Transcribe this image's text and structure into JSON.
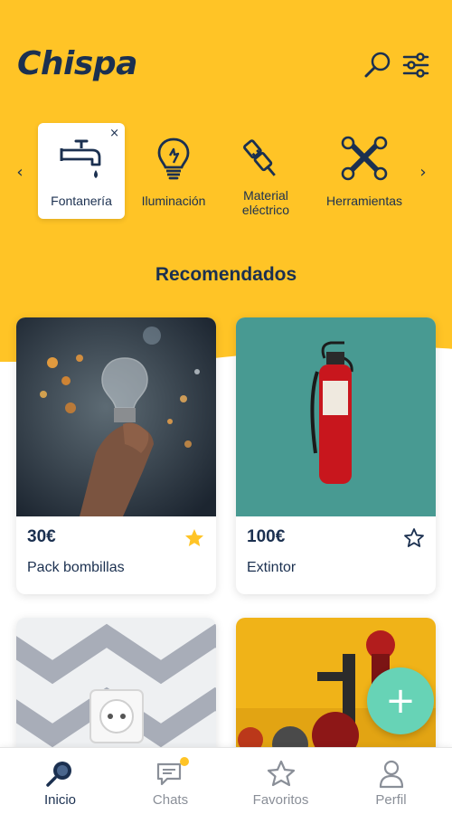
{
  "app": {
    "name": "Chispa"
  },
  "colors": {
    "brand_yellow": "#FFC426",
    "navy": "#1b3050",
    "fab": "#67d3b6",
    "star_active": "#FFC426",
    "muted": "#8a8f98"
  },
  "header": {
    "search_icon": "search-icon",
    "filter_icon": "sliders-icon"
  },
  "categories": {
    "prev_icon": "‹",
    "next_icon": "›",
    "items": [
      {
        "label": "Fontanería",
        "icon": "faucet-icon",
        "active": true,
        "close": "×"
      },
      {
        "label": "Iluminación",
        "icon": "lightbulb-icon",
        "active": false
      },
      {
        "label": "Material eléctrico",
        "label_line1": "Material",
        "label_line2": "eléctrico",
        "icon": "plug-icon",
        "active": false
      },
      {
        "label": "Herramientas",
        "icon": "tools-icon",
        "active": false
      }
    ]
  },
  "section": {
    "title": "Recomendados"
  },
  "products": [
    {
      "price": "30€",
      "title": "Pack bombillas",
      "favorite": true,
      "image": "lightbulb-photo"
    },
    {
      "price": "100€",
      "title": "Extintor",
      "favorite": false,
      "image": "extinguisher-photo"
    },
    {
      "price": "",
      "title": "",
      "favorite": false,
      "image": "outlet-photo"
    },
    {
      "price": "",
      "title": "",
      "favorite": false,
      "image": "valves-photo"
    }
  ],
  "fab": {
    "label": "+"
  },
  "nav": [
    {
      "label": "Inicio",
      "icon": "home-search-icon",
      "active": true
    },
    {
      "label": "Chats",
      "icon": "chat-icon",
      "active": false,
      "badge": true
    },
    {
      "label": "Favoritos",
      "icon": "star-icon",
      "active": false
    },
    {
      "label": "Perfil",
      "icon": "person-icon",
      "active": false
    }
  ]
}
